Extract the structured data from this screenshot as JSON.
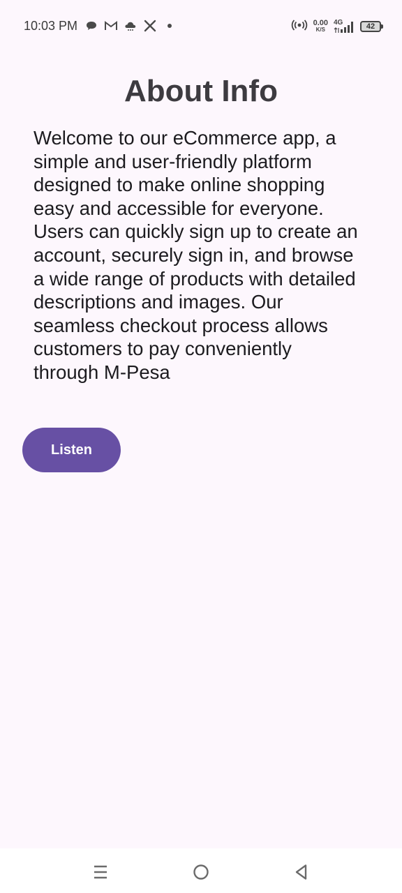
{
  "status_bar": {
    "time": "10:03 PM",
    "left_icons": [
      "chat-bubble-icon",
      "gmail-icon",
      "weather-cloud-icon",
      "x-app-icon",
      "more-dot-icon"
    ],
    "net_speed_value": "0.00",
    "net_speed_unit": "K/S",
    "network_type": "4G",
    "battery_level": "42",
    "icons_right": [
      "hotspot-icon",
      "signal-icon",
      "battery-icon"
    ]
  },
  "page": {
    "title": "About Info",
    "description": "Welcome to our eCommerce app, a simple and user-friendly platform designed to make online shopping easy and accessible for everyone. Users can quickly sign up to create an account, securely sign in, and browse a wide range of products with detailed descriptions and images. Our seamless checkout process allows customers to pay conveniently through M-Pesa",
    "listen_button_label": "Listen"
  },
  "nav_bar": {
    "buttons": [
      "recents-icon",
      "home-icon",
      "back-icon"
    ]
  },
  "colors": {
    "background": "#fdf7fd",
    "accent": "#6750a4",
    "title_text": "#3d3b40",
    "body_text": "#1c1b1f"
  }
}
